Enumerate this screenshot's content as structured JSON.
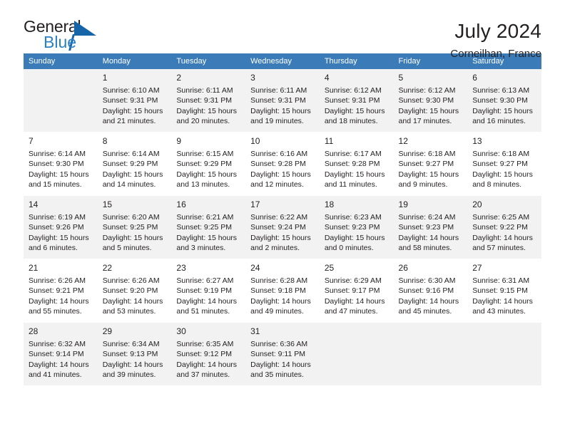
{
  "brand": {
    "name_part1": "General",
    "name_part2": "Blue",
    "accent_color": "#2b7fc4",
    "triangle_color": "#1565a8"
  },
  "header": {
    "title": "July 2024",
    "subtitle": "Corneilhan, France"
  },
  "calendar": {
    "header_bg": "#3b7cb8",
    "weekday_headers": [
      "Sunday",
      "Monday",
      "Tuesday",
      "Wednesday",
      "Thursday",
      "Friday",
      "Saturday"
    ],
    "weeks": [
      [
        {
          "day": "",
          "info": ""
        },
        {
          "day": "1",
          "info": "Sunrise: 6:10 AM\nSunset: 9:31 PM\nDaylight: 15 hours\nand 21 minutes."
        },
        {
          "day": "2",
          "info": "Sunrise: 6:11 AM\nSunset: 9:31 PM\nDaylight: 15 hours\nand 20 minutes."
        },
        {
          "day": "3",
          "info": "Sunrise: 6:11 AM\nSunset: 9:31 PM\nDaylight: 15 hours\nand 19 minutes."
        },
        {
          "day": "4",
          "info": "Sunrise: 6:12 AM\nSunset: 9:31 PM\nDaylight: 15 hours\nand 18 minutes."
        },
        {
          "day": "5",
          "info": "Sunrise: 6:12 AM\nSunset: 9:30 PM\nDaylight: 15 hours\nand 17 minutes."
        },
        {
          "day": "6",
          "info": "Sunrise: 6:13 AM\nSunset: 9:30 PM\nDaylight: 15 hours\nand 16 minutes."
        }
      ],
      [
        {
          "day": "7",
          "info": "Sunrise: 6:14 AM\nSunset: 9:30 PM\nDaylight: 15 hours\nand 15 minutes."
        },
        {
          "day": "8",
          "info": "Sunrise: 6:14 AM\nSunset: 9:29 PM\nDaylight: 15 hours\nand 14 minutes."
        },
        {
          "day": "9",
          "info": "Sunrise: 6:15 AM\nSunset: 9:29 PM\nDaylight: 15 hours\nand 13 minutes."
        },
        {
          "day": "10",
          "info": "Sunrise: 6:16 AM\nSunset: 9:28 PM\nDaylight: 15 hours\nand 12 minutes."
        },
        {
          "day": "11",
          "info": "Sunrise: 6:17 AM\nSunset: 9:28 PM\nDaylight: 15 hours\nand 11 minutes."
        },
        {
          "day": "12",
          "info": "Sunrise: 6:18 AM\nSunset: 9:27 PM\nDaylight: 15 hours\nand 9 minutes."
        },
        {
          "day": "13",
          "info": "Sunrise: 6:18 AM\nSunset: 9:27 PM\nDaylight: 15 hours\nand 8 minutes."
        }
      ],
      [
        {
          "day": "14",
          "info": "Sunrise: 6:19 AM\nSunset: 9:26 PM\nDaylight: 15 hours\nand 6 minutes."
        },
        {
          "day": "15",
          "info": "Sunrise: 6:20 AM\nSunset: 9:25 PM\nDaylight: 15 hours\nand 5 minutes."
        },
        {
          "day": "16",
          "info": "Sunrise: 6:21 AM\nSunset: 9:25 PM\nDaylight: 15 hours\nand 3 minutes."
        },
        {
          "day": "17",
          "info": "Sunrise: 6:22 AM\nSunset: 9:24 PM\nDaylight: 15 hours\nand 2 minutes."
        },
        {
          "day": "18",
          "info": "Sunrise: 6:23 AM\nSunset: 9:23 PM\nDaylight: 15 hours\nand 0 minutes."
        },
        {
          "day": "19",
          "info": "Sunrise: 6:24 AM\nSunset: 9:23 PM\nDaylight: 14 hours\nand 58 minutes."
        },
        {
          "day": "20",
          "info": "Sunrise: 6:25 AM\nSunset: 9:22 PM\nDaylight: 14 hours\nand 57 minutes."
        }
      ],
      [
        {
          "day": "21",
          "info": "Sunrise: 6:26 AM\nSunset: 9:21 PM\nDaylight: 14 hours\nand 55 minutes."
        },
        {
          "day": "22",
          "info": "Sunrise: 6:26 AM\nSunset: 9:20 PM\nDaylight: 14 hours\nand 53 minutes."
        },
        {
          "day": "23",
          "info": "Sunrise: 6:27 AM\nSunset: 9:19 PM\nDaylight: 14 hours\nand 51 minutes."
        },
        {
          "day": "24",
          "info": "Sunrise: 6:28 AM\nSunset: 9:18 PM\nDaylight: 14 hours\nand 49 minutes."
        },
        {
          "day": "25",
          "info": "Sunrise: 6:29 AM\nSunset: 9:17 PM\nDaylight: 14 hours\nand 47 minutes."
        },
        {
          "day": "26",
          "info": "Sunrise: 6:30 AM\nSunset: 9:16 PM\nDaylight: 14 hours\nand 45 minutes."
        },
        {
          "day": "27",
          "info": "Sunrise: 6:31 AM\nSunset: 9:15 PM\nDaylight: 14 hours\nand 43 minutes."
        }
      ],
      [
        {
          "day": "28",
          "info": "Sunrise: 6:32 AM\nSunset: 9:14 PM\nDaylight: 14 hours\nand 41 minutes."
        },
        {
          "day": "29",
          "info": "Sunrise: 6:34 AM\nSunset: 9:13 PM\nDaylight: 14 hours\nand 39 minutes."
        },
        {
          "day": "30",
          "info": "Sunrise: 6:35 AM\nSunset: 9:12 PM\nDaylight: 14 hours\nand 37 minutes."
        },
        {
          "day": "31",
          "info": "Sunrise: 6:36 AM\nSunset: 9:11 PM\nDaylight: 14 hours\nand 35 minutes."
        },
        {
          "day": "",
          "info": ""
        },
        {
          "day": "",
          "info": ""
        },
        {
          "day": "",
          "info": ""
        }
      ]
    ]
  }
}
